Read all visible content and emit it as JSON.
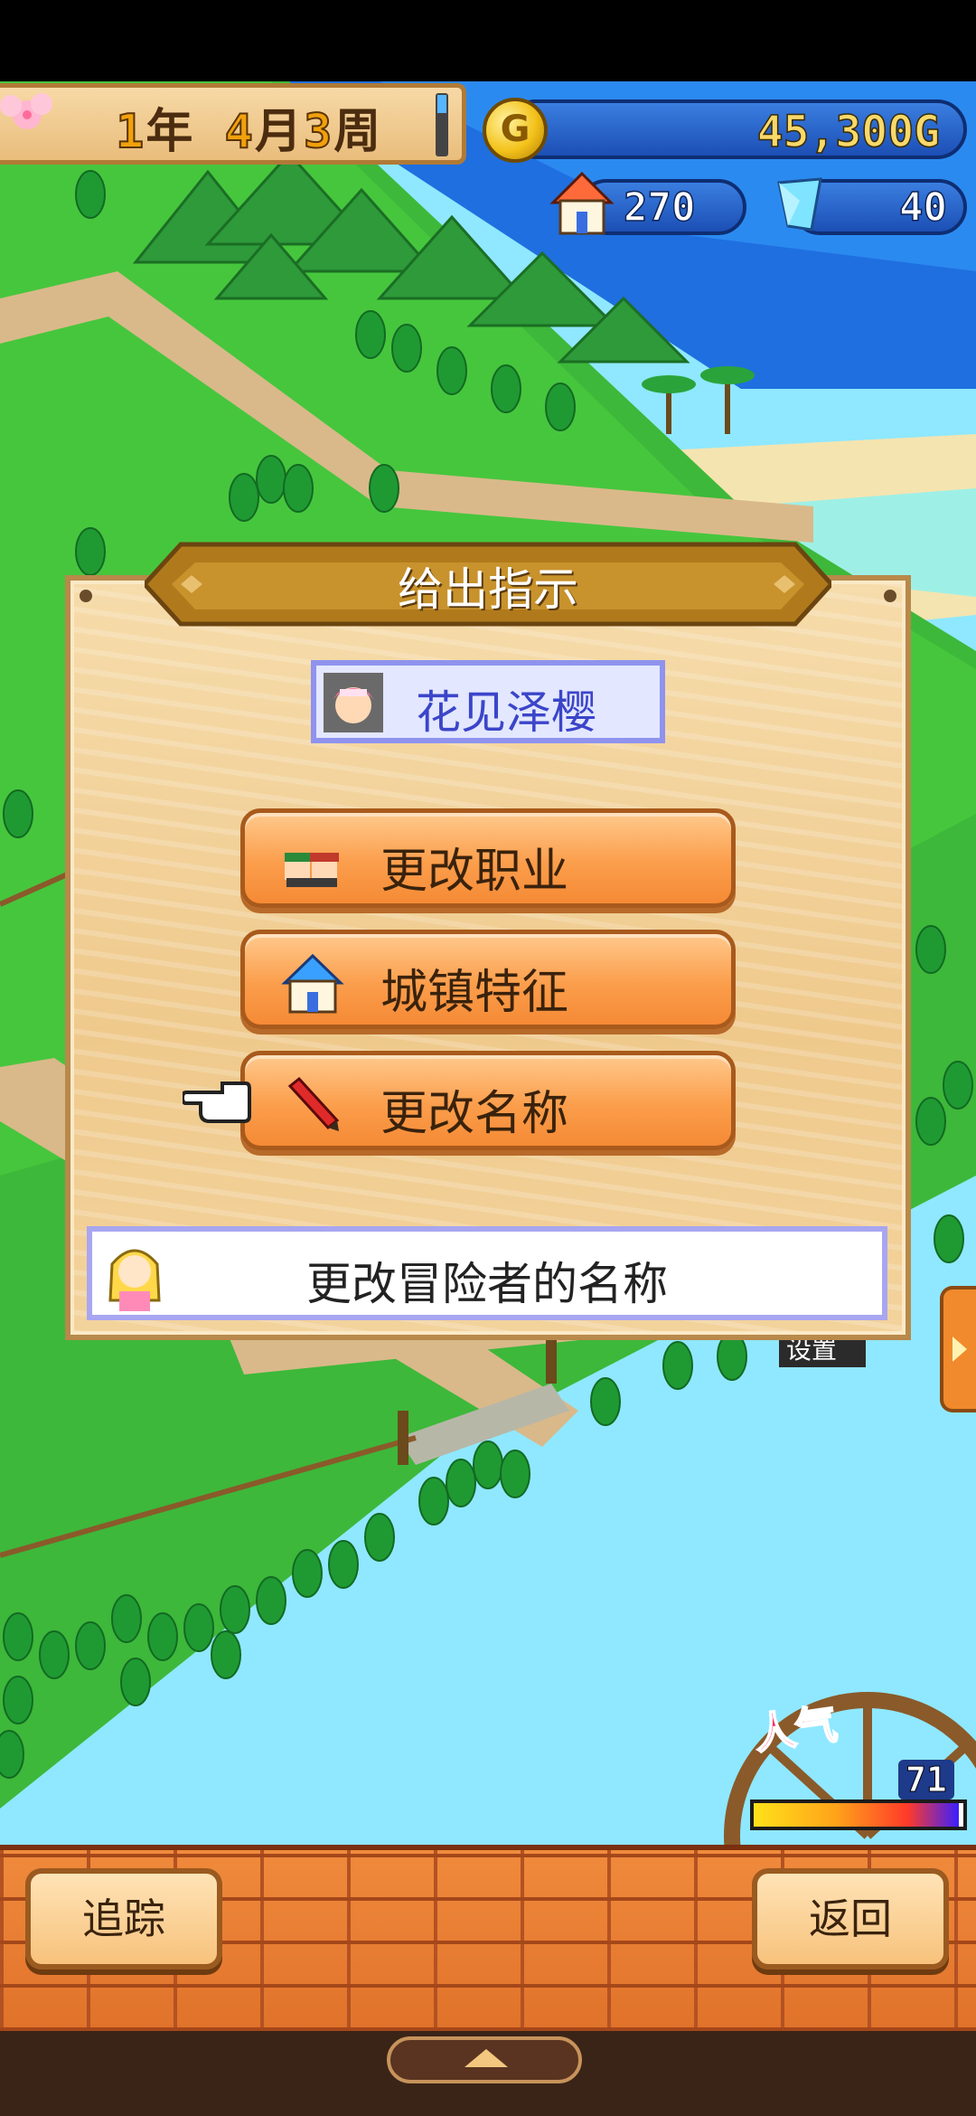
{
  "hud": {
    "date": {
      "year": "1",
      "year_unit": "年",
      "month": "4",
      "month_unit": "月",
      "week": "3",
      "week_unit": "周"
    },
    "gold": "45,300G",
    "coin_letter": "G",
    "population": "270",
    "gems": "40"
  },
  "dialog": {
    "title": "给出指示",
    "character_name": "花见泽樱",
    "menu": [
      {
        "label": "更改职业",
        "icon": "people-icon"
      },
      {
        "label": "城镇特征",
        "icon": "house-icon"
      },
      {
        "label": "更改名称",
        "icon": "pencil-icon"
      }
    ],
    "selected_index": 2,
    "description": "更改冒险者的名称"
  },
  "map_sign": "设置",
  "popularity": {
    "label": "人气",
    "value": "71",
    "fill_fraction": 0.98
  },
  "bottom": {
    "track_label": "追踪",
    "back_label": "返回"
  },
  "colors": {
    "accent_orange": "#f58a35",
    "panel_blue": "#1c4fb5",
    "name_blue": "#3b45c9"
  }
}
